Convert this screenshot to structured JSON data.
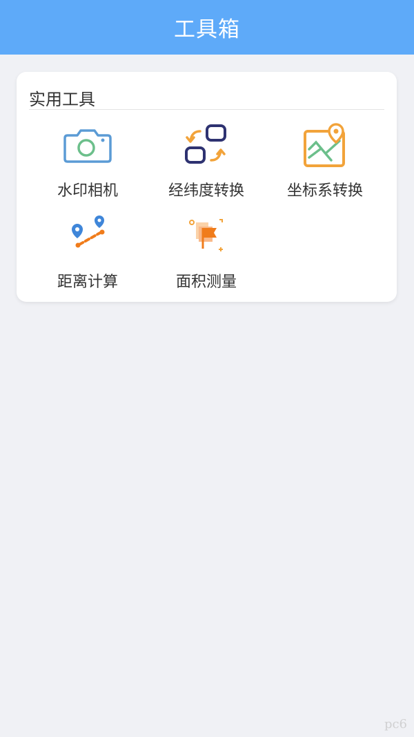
{
  "header": {
    "title": "工具箱"
  },
  "section": {
    "title": "实用工具"
  },
  "tools": [
    {
      "label": "水印相机",
      "icon": "camera-icon"
    },
    {
      "label": "经纬度转换",
      "icon": "coordinate-swap-icon"
    },
    {
      "label": "坐标系转换",
      "icon": "map-pin-icon"
    },
    {
      "label": "距离计算",
      "icon": "distance-icon"
    },
    {
      "label": "面积测量",
      "icon": "flag-area-icon"
    }
  ],
  "watermark": "pc6",
  "colors": {
    "header_bg": "#5eaaf9",
    "page_bg": "#f0f1f5",
    "blue": "#5b9bd5",
    "navy": "#2e3271",
    "orange": "#f2a33a",
    "green": "#6cbf8b",
    "accent_orange": "#f07c1b"
  }
}
